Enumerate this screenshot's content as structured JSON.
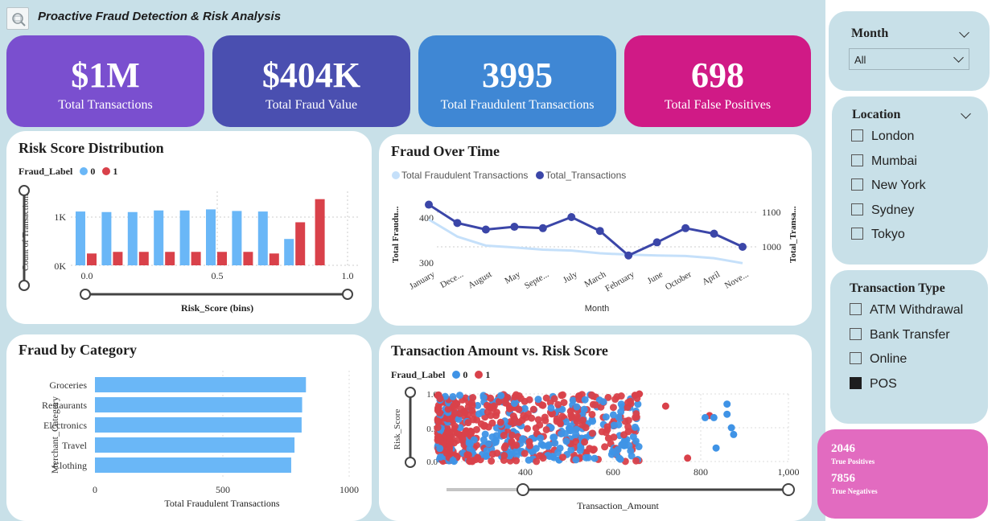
{
  "header": {
    "title": "Proactive Fraud Detection & Risk Analysis"
  },
  "kpis": [
    {
      "value": "$1M",
      "label": "Total Transactions",
      "color": "#7a4fcf"
    },
    {
      "value": "$404K",
      "label": "Total Fraud Value",
      "color": "#4a4fb0"
    },
    {
      "value": "3995",
      "label": "Total Fraudulent Transactions",
      "color": "#3f87d4"
    },
    {
      "value": "698",
      "label": "Total False Positives",
      "color": "#d01a86"
    }
  ],
  "risk_panel": {
    "title": "Risk Score Distribution",
    "legend_title": "Fraud_Label",
    "legend": [
      "0",
      "1"
    ],
    "ylabel": "Count of Transaction...",
    "xlabel": "Risk_Score (bins)",
    "yticks": [
      "1K",
      "0K"
    ],
    "xticks": [
      "0.0",
      "0.5",
      "1.0"
    ]
  },
  "time_panel": {
    "title": "Fraud Over Time",
    "legend": [
      "Total Fraudulent Transactions",
      "Total_Transactions"
    ],
    "ylabel_left": "Total Fraudu...",
    "ylabel_right": "Total_Transa...",
    "xlabel": "Month",
    "yticks_left": [
      "400",
      "300"
    ],
    "yticks_right": [
      "1100",
      "1000"
    ],
    "xticks": [
      "January",
      "Dece...",
      "August",
      "May",
      "Septe...",
      "July",
      "March",
      "February",
      "June",
      "October",
      "April",
      "Nove..."
    ]
  },
  "category_panel": {
    "title": "Fraud by Category",
    "ylabel": "Merchant_Category",
    "xlabel": "Total Fraudulent Transactions",
    "categories": [
      "Groceries",
      "Restaurants",
      "Electronics",
      "Travel",
      "Clothing"
    ],
    "xticks": [
      "0",
      "500",
      "1000"
    ]
  },
  "scatter_panel": {
    "title": "Transaction Amount vs. Risk Score",
    "legend_title": "Fraud_Label",
    "legend": [
      "0",
      "1"
    ],
    "ylabel": "Risk_Score",
    "xlabel": "Transaction_Amount",
    "yticks": [
      "1.0",
      "0.5",
      "0.0"
    ],
    "xticks": [
      "400",
      "600",
      "800",
      "1,000"
    ]
  },
  "slicers": {
    "month": {
      "title": "Month",
      "selected": "All"
    },
    "location": {
      "title": "Location",
      "items": [
        "London",
        "Mumbai",
        "New York",
        "Sydney",
        "Tokyo"
      ]
    },
    "transaction_type": {
      "title": "Transaction Type",
      "items": [
        "ATM Withdrawal",
        "Bank Transfer",
        "Online",
        "POS"
      ],
      "checked": [
        "POS"
      ]
    }
  },
  "confusion": {
    "true_positives": "2046",
    "true_positives_label": "True Positives",
    "true_negatives": "7856",
    "true_negatives_label": "True Negatives"
  },
  "chart_data": [
    {
      "type": "bar",
      "title": "Risk Score Distribution",
      "xlabel": "Risk_Score (bins)",
      "ylabel": "Count of Transaction...",
      "categories": [
        "0.0",
        "0.1",
        "0.2",
        "0.3",
        "0.4",
        "0.5",
        "0.6",
        "0.7",
        "0.8",
        "0.9"
      ],
      "series": [
        {
          "name": "0",
          "color": "#6ab7f7",
          "values": [
            1000,
            990,
            990,
            1020,
            1020,
            1040,
            1010,
            1000,
            490,
            0
          ]
        },
        {
          "name": "1",
          "color": "#d9414a",
          "values": [
            220,
            250,
            250,
            250,
            250,
            250,
            250,
            220,
            800,
            1230
          ]
        }
      ],
      "ylim": [
        0,
        1300
      ]
    },
    {
      "type": "line",
      "title": "Fraud Over Time",
      "xlabel": "Month",
      "categories": [
        "January",
        "December",
        "August",
        "May",
        "September",
        "July",
        "March",
        "February",
        "June",
        "October",
        "April",
        "November"
      ],
      "series": [
        {
          "name": "Total Fraudulent Transactions",
          "axis": "left",
          "color": "#c5e0fa",
          "values": [
            400,
            362,
            342,
            338,
            333,
            331,
            325,
            322,
            320,
            319,
            314,
            303
          ]
        },
        {
          "name": "Total_Transactions",
          "axis": "right",
          "color": "#3b46a8",
          "values": [
            1122,
            1069,
            1050,
            1058,
            1054,
            1086,
            1046,
            975,
            1013,
            1054,
            1038,
            1000
          ]
        }
      ],
      "ylim_left": [
        290,
        430
      ],
      "ylim_right": [
        970,
        1140
      ]
    },
    {
      "type": "bar",
      "orientation": "horizontal",
      "title": "Fraud by Category",
      "xlabel": "Total Fraudulent Transactions",
      "ylabel": "Merchant_Category",
      "categories": [
        "Groceries",
        "Restaurants",
        "Electronics",
        "Travel",
        "Clothing"
      ],
      "values": [
        830,
        815,
        813,
        785,
        772
      ],
      "color": "#6ab7f7",
      "xlim": [
        0,
        1000
      ]
    },
    {
      "type": "scatter",
      "title": "Transaction Amount vs. Risk Score",
      "xlabel": "Transaction_Amount",
      "ylabel": "Risk_Score",
      "xlim": [
        200,
        1000
      ],
      "ylim": [
        0,
        1
      ],
      "series": [
        {
          "name": "1",
          "color": "#d9414a",
          "points": [
            [
              770,
              0.05
            ],
            [
              820,
              0.68
            ],
            [
              720,
              0.82
            ],
            [
              660,
              1.0
            ],
            [
              650,
              0.98
            ]
          ]
        },
        {
          "name": "0",
          "color": "#3f93e6",
          "points": [
            [
              860,
              0.85
            ],
            [
              860,
              0.7
            ],
            [
              870,
              0.5
            ],
            [
              830,
              0.65
            ],
            [
              810,
              0.65
            ],
            [
              835,
              0.2
            ],
            [
              875,
              0.4
            ]
          ]
        }
      ]
    }
  ]
}
